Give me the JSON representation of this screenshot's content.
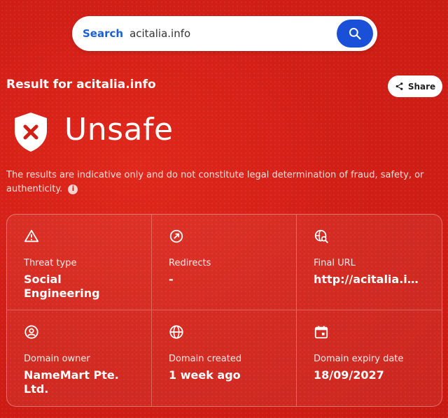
{
  "search": {
    "label": "Search",
    "value": "acitalia.info"
  },
  "result": {
    "title": "Result for acitalia.info",
    "share_label": "Share",
    "verdict": "Unsafe",
    "disclaimer": "The results are indicative only and do not constitute legal determination of fraud, safety, or authenticity."
  },
  "details": [
    {
      "icon": "warning-icon",
      "label": "Threat type",
      "value": "Social Engineering"
    },
    {
      "icon": "redirect-icon",
      "label": "Redirects",
      "value": "-"
    },
    {
      "icon": "globe-search-icon",
      "label": "Final URL",
      "value": "http://acitalia.in..."
    },
    {
      "icon": "user-circle-icon",
      "label": "Domain owner",
      "value": "NameMart Pte. Ltd."
    },
    {
      "icon": "globe-icon",
      "label": "Domain created",
      "value": "1 week ago"
    },
    {
      "icon": "calendar-icon",
      "label": "Domain expiry date",
      "value": "18/09/2027"
    }
  ],
  "colors": {
    "background": "#d21f16",
    "search_label": "#1a5fd6",
    "search_button": "#1a4fd8",
    "shield": "#ffffff",
    "shield_x": "#d21f16"
  }
}
